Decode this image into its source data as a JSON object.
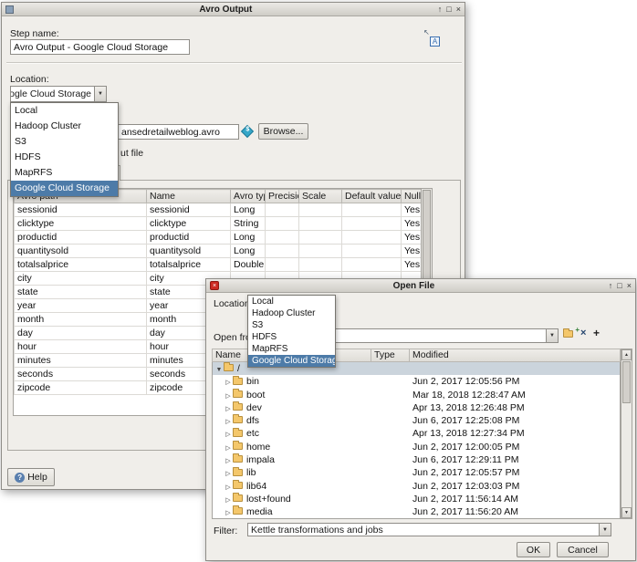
{
  "icons": {
    "minimize": "↑",
    "maximize": "□",
    "close": "×",
    "dropdown_arrow": "▼",
    "expander_open": "▼",
    "expander_closed": "▷",
    "help_glyph": "?",
    "variable_glyph": "$",
    "a_icon_letter": "A",
    "a_icon_arrow": "↖",
    "app_icon_glyph": "×",
    "new_folder_glyph": "+",
    "delete_glyph": "×",
    "add_glyph": "+",
    "scroll_up": "▲",
    "scroll_down": "▼"
  },
  "avro_window": {
    "title": "Avro Output",
    "step_name_label": "Step name:",
    "step_name_value": "Avro Output - Google Cloud Storage",
    "location_label": "Location:",
    "location_value": "Google Cloud Storage",
    "location_options": [
      "Local",
      "Hadoop Cluster",
      "S3",
      "HDFS",
      "MapRFS",
      "Google Cloud Storage"
    ],
    "location_selected": "Google Cloud Storage",
    "filename_value": "ansedretailweblog.avro",
    "browse_label": "Browse...",
    "overwrite_label_visible": "ut file",
    "help_label": "Help",
    "fields_table": {
      "headers": [
        "Avro path",
        "Name",
        "Avro type",
        "Precision",
        "Scale",
        "Default value",
        "Null"
      ],
      "rows": [
        [
          "sessionid",
          "sessionid",
          "Long",
          "",
          "",
          "",
          "Yes"
        ],
        [
          "clicktype",
          "clicktype",
          "String",
          "",
          "",
          "",
          "Yes"
        ],
        [
          "productid",
          "productid",
          "Long",
          "",
          "",
          "",
          "Yes"
        ],
        [
          "quantitysold",
          "quantitysold",
          "Long",
          "",
          "",
          "",
          "Yes"
        ],
        [
          "totalsalprice",
          "totalsalprice",
          "Double",
          "",
          "",
          "",
          "Yes"
        ],
        [
          "city",
          "city",
          "",
          "",
          "",
          "",
          ""
        ],
        [
          "state",
          "state",
          "",
          "",
          "",
          "",
          ""
        ],
        [
          "year",
          "year",
          "",
          "",
          "",
          "",
          ""
        ],
        [
          "month",
          "month",
          "",
          "",
          "",
          "",
          ""
        ],
        [
          "day",
          "day",
          "",
          "",
          "",
          "",
          ""
        ],
        [
          "hour",
          "hour",
          "",
          "",
          "",
          "",
          ""
        ],
        [
          "minutes",
          "minutes",
          "",
          "",
          "",
          "",
          ""
        ],
        [
          "seconds",
          "seconds",
          "",
          "",
          "",
          "",
          ""
        ],
        [
          "zipcode",
          "zipcode",
          "",
          "",
          "",
          "",
          ""
        ]
      ]
    }
  },
  "open_file_window": {
    "title": "Open File",
    "location_label": "Location:",
    "location_options": [
      "Local",
      "Hadoop Cluster",
      "S3",
      "HDFS",
      "MapRFS",
      "Google Cloud Storage"
    ],
    "location_selected": "Google Cloud Storage",
    "open_from_label": "Open from",
    "file_table": {
      "headers": [
        "Name",
        "Type",
        "Modified"
      ],
      "root_name": "/",
      "rows": [
        {
          "name": "bin",
          "type": "",
          "modified": "Jun 2, 2017 12:05:56 PM"
        },
        {
          "name": "boot",
          "type": "",
          "modified": "Mar 18, 2018 12:28:47 AM"
        },
        {
          "name": "dev",
          "type": "",
          "modified": "Apr 13, 2018 12:26:48 PM"
        },
        {
          "name": "dfs",
          "type": "",
          "modified": "Jun 6, 2017 12:25:08 PM"
        },
        {
          "name": "etc",
          "type": "",
          "modified": "Apr 13, 2018 12:27:34 PM"
        },
        {
          "name": "home",
          "type": "",
          "modified": "Jun 2, 2017 12:00:05 PM"
        },
        {
          "name": "impala",
          "type": "",
          "modified": "Jun 6, 2017 12:29:11 PM"
        },
        {
          "name": "lib",
          "type": "",
          "modified": "Jun 2, 2017 12:05:57 PM"
        },
        {
          "name": "lib64",
          "type": "",
          "modified": "Jun 2, 2017 12:03:03 PM"
        },
        {
          "name": "lost+found",
          "type": "",
          "modified": "Jun 2, 2017 11:56:14 AM"
        },
        {
          "name": "media",
          "type": "",
          "modified": "Jun 2, 2017 11:56:20 AM"
        }
      ]
    },
    "filter_label": "Filter:",
    "filter_value": "Kettle transformations and jobs",
    "ok_label": "OK",
    "cancel_label": "Cancel"
  },
  "colors": {
    "selection_blue": "#4d7ba8",
    "row_selection": "#cbd4dc",
    "window_bg": "#f0eeea",
    "folder_yellow": "#f4c76b"
  }
}
